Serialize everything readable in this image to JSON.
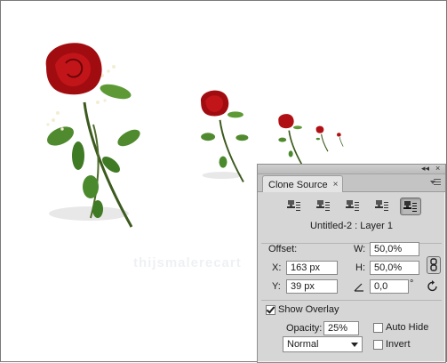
{
  "watermark": "thijsmalerecart",
  "panel": {
    "tab_label": "Clone Source",
    "tab_close": "×",
    "collapse_glyph": "◂◂",
    "close_glyph": "×",
    "layer_label": "Untitled-2 : Layer 1",
    "offset_label": "Offset:",
    "x_label": "X:",
    "x_value": "163 px",
    "y_label": "Y:",
    "y_value": "39 px",
    "w_label": "W:",
    "w_value": "50,0%",
    "h_label": "H:",
    "h_value": "50,0%",
    "angle_value": "0,0",
    "degree_symbol": "°",
    "show_overlay_label": "Show Overlay",
    "show_overlay_checked": true,
    "opacity_label": "Opacity:",
    "opacity_value": "25%",
    "blend_mode": "Normal",
    "auto_hide_label": "Auto Hide",
    "auto_hide_checked": false,
    "invert_label": "Invert",
    "invert_checked": false,
    "active_source_index": 5
  },
  "icons": {
    "clone_source_button": "clone-source-stamp-icon",
    "link": "link-chain-icon",
    "angle": "angle-icon",
    "reset": "reset-transform-icon",
    "menu": "panel-menu-icon"
  }
}
